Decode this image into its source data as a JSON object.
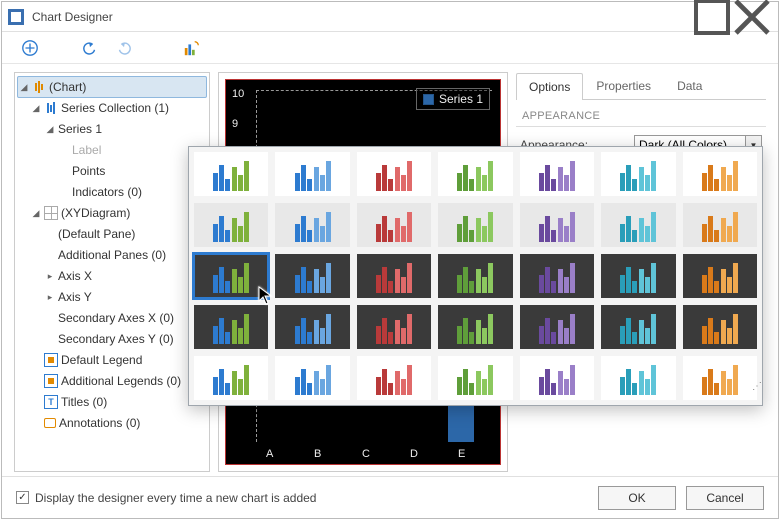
{
  "window": {
    "title": "Chart Designer"
  },
  "toolbar": {
    "add_icon": "plus-circle",
    "undo_icon": "undo",
    "redo_icon": "redo",
    "palette_icon": "palette"
  },
  "tree": {
    "root": "(Chart)",
    "series_collection": "Series Collection (1)",
    "series1": "Series 1",
    "label": "Label",
    "points": "Points",
    "indicators": "Indicators (0)",
    "diagram": "(XYDiagram)",
    "default_pane": "(Default Pane)",
    "additional_panes": "Additional Panes (0)",
    "axis_x": "Axis X",
    "axis_y": "Axis Y",
    "sec_axes_x": "Secondary Axes X (0)",
    "sec_axes_y": "Secondary Axes Y (0)",
    "default_legend": "Default Legend",
    "additional_legends": "Additional Legends (0)",
    "titles": "Titles (0)",
    "annotations": "Annotations (0)"
  },
  "chart": {
    "legend_label": "Series 1",
    "y_ticks": [
      "10",
      "9"
    ],
    "x_ticks": [
      "A",
      "B",
      "C",
      "D",
      "E"
    ]
  },
  "right": {
    "tabs": {
      "options": "Options",
      "properties": "Properties",
      "data": "Data"
    },
    "section": "APPEARANCE",
    "appearance_label": "Appearance:",
    "appearance_value": "Dark (All Colors)"
  },
  "footer": {
    "checkbox_label": "Display the designer every time a new chart is added",
    "checkbox_checked": true,
    "ok": "OK",
    "cancel": "Cancel"
  },
  "palette": {
    "selected": [
      2,
      0
    ],
    "rows": [
      {
        "bg": "white",
        "styles": [
          "bg",
          "bb",
          "rr",
          "gg",
          "pp",
          "cc",
          "oo"
        ]
      },
      {
        "bg": "gray",
        "styles": [
          "bg",
          "bb",
          "rr",
          "gg",
          "pp",
          "cc",
          "oo"
        ]
      },
      {
        "bg": "dark",
        "styles": [
          "bg",
          "bb",
          "rr",
          "gg",
          "pp",
          "cc",
          "oo"
        ]
      },
      {
        "bg": "dark",
        "styles": [
          "bg",
          "bb",
          "rr",
          "gg",
          "pp",
          "cc",
          "oo"
        ]
      },
      {
        "bg": "white",
        "styles": [
          "bg",
          "bb",
          "rr",
          "gg",
          "pp",
          "cc",
          "oo"
        ]
      }
    ],
    "style_colors": {
      "bg": [
        "#2d7bd0",
        "#7fb13c"
      ],
      "bb": [
        "#2d7bd0",
        "#6aa6e0"
      ],
      "rr": [
        "#b93a3a",
        "#e06a6a"
      ],
      "gg": [
        "#5f9e3a",
        "#8cc85f"
      ],
      "pp": [
        "#6a4a9e",
        "#9a7fc8"
      ],
      "cc": [
        "#2a9eb9",
        "#5fc4d8"
      ],
      "oo": [
        "#d97a1a",
        "#f0a950"
      ]
    },
    "subbars": [
      {
        "heights": [
          18,
          26,
          12
        ]
      },
      {
        "heights": [
          24,
          16,
          30
        ]
      }
    ]
  },
  "chart_data": {
    "type": "bar",
    "title": "",
    "categories": [
      "A",
      "B",
      "C",
      "D",
      "E"
    ],
    "series": [
      {
        "name": "Series 1",
        "values": [
          null,
          null,
          null,
          null,
          9
        ]
      }
    ],
    "ylim": [
      0,
      10
    ],
    "visible_y_ticks": [
      10,
      9
    ],
    "xlabel": "",
    "ylabel": "",
    "note": "Bars A–D are hidden behind a popup; only bar E (~9) and y-ticks 10 and 9 are visible in the screenshot."
  }
}
